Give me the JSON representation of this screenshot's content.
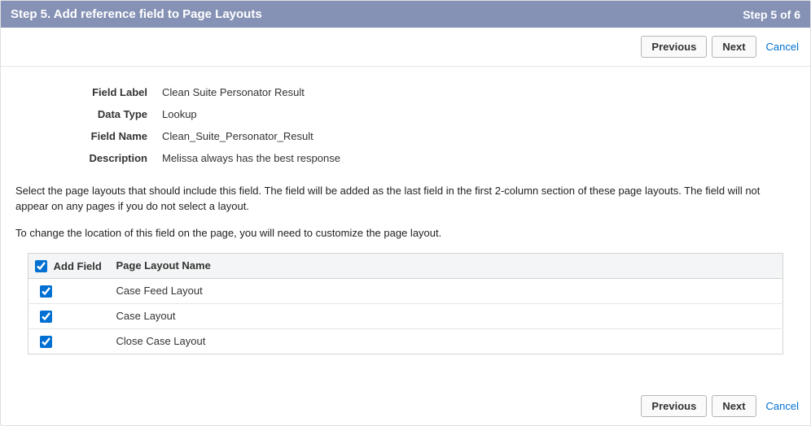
{
  "header": {
    "title": "Step 5. Add reference field to Page Layouts",
    "step_indicator": "Step 5 of 6"
  },
  "buttons": {
    "previous": "Previous",
    "next": "Next",
    "cancel": "Cancel"
  },
  "definition": {
    "field_label_k": "Field Label",
    "field_label_v": "Clean Suite Personator Result",
    "data_type_k": "Data Type",
    "data_type_v": "Lookup",
    "field_name_k": "Field Name",
    "field_name_v": "Clean_Suite_Personator_Result",
    "description_k": "Description",
    "description_v": "Melissa always has the best response"
  },
  "instructions": {
    "para1": "Select the page layouts that should include this field. The field will be added as the last field in the first 2-column section of these page layouts. The field will not appear on any pages if you do not select a layout.",
    "para2": "To change the location of this field on the page, you will need to customize the page layout."
  },
  "table": {
    "header_addfield": "Add Field",
    "header_layoutname": "Page Layout Name",
    "rows": {
      "0": {
        "name": "Case Feed Layout"
      },
      "1": {
        "name": "Case Layout"
      },
      "2": {
        "name": "Close Case Layout"
      }
    }
  }
}
